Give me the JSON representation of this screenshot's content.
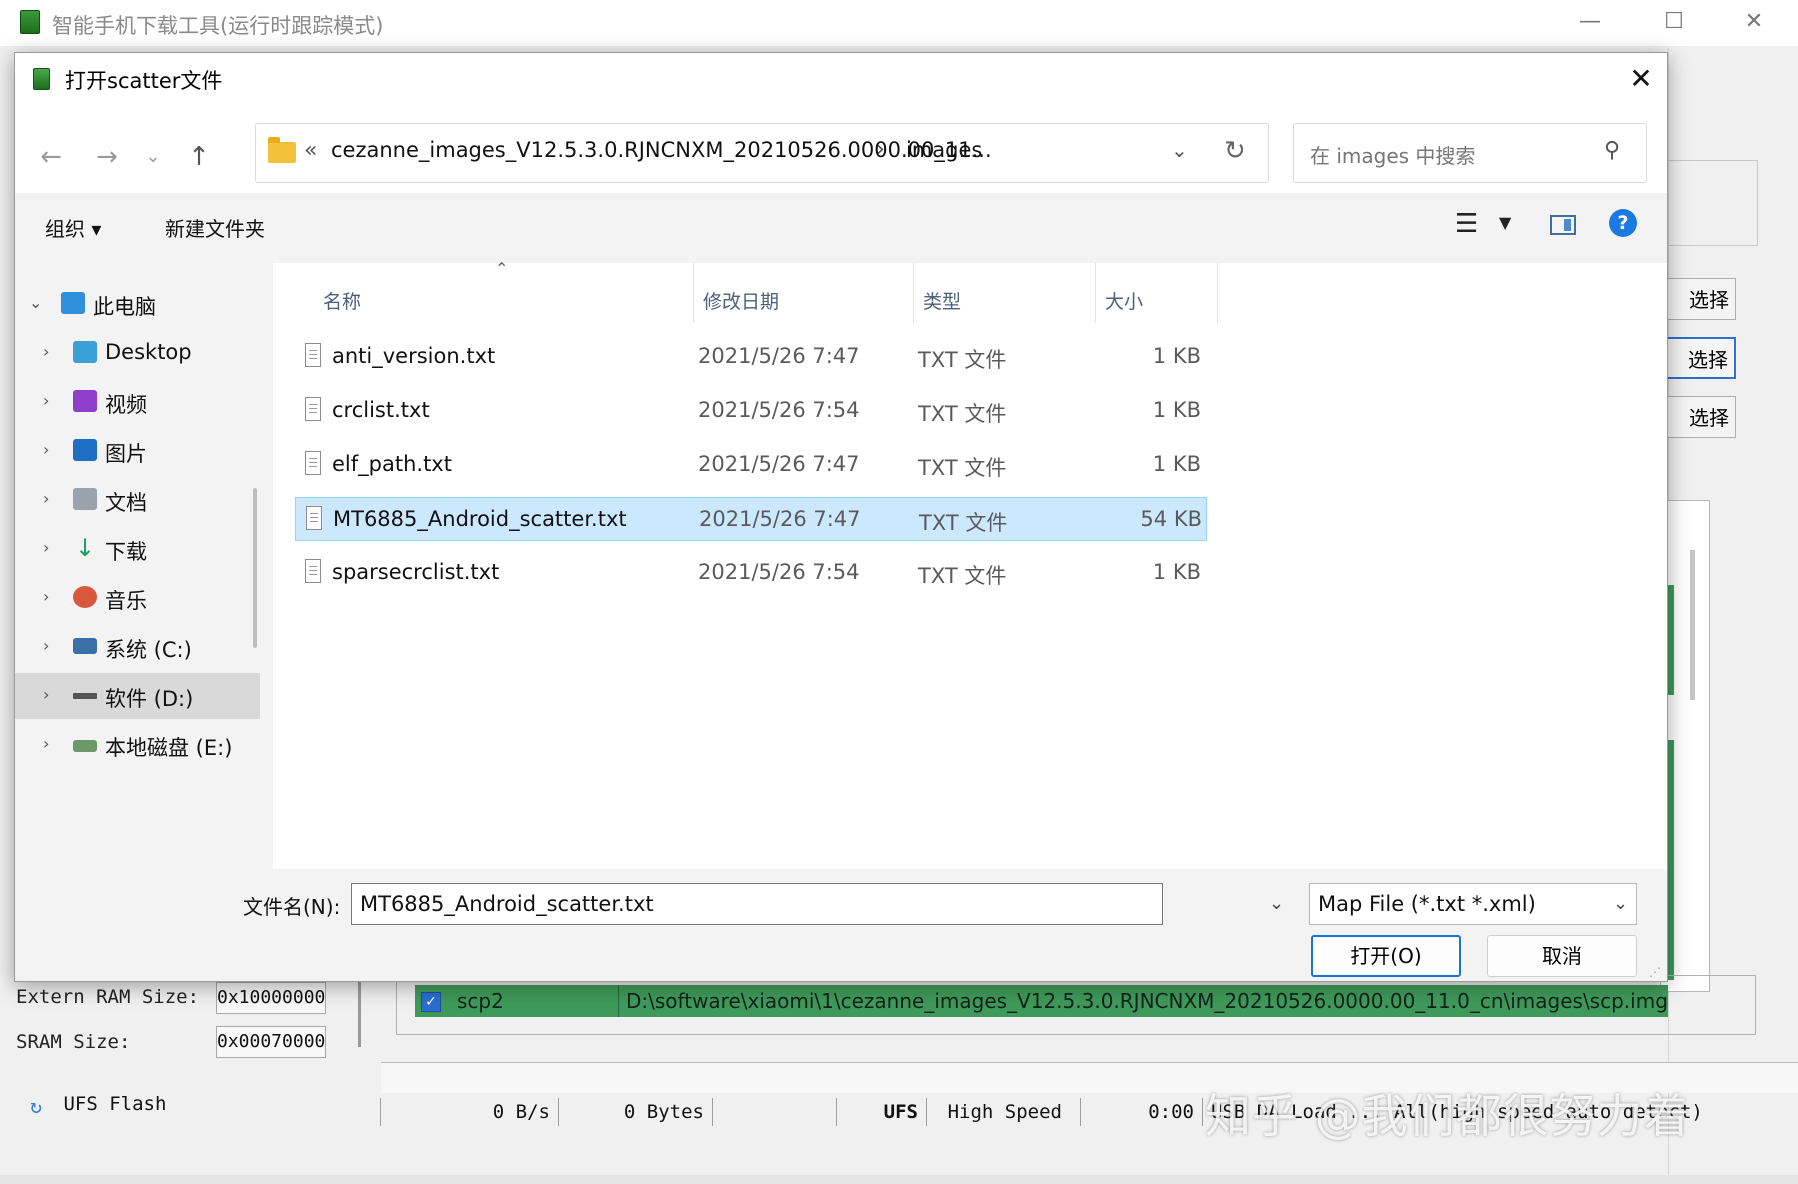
{
  "app": {
    "title": "智能手机下载工具(运行时跟踪模式)",
    "minimize": "—",
    "maximize": "☐",
    "close": "✕",
    "side_buttons": [
      "选择",
      "选择",
      "选择"
    ],
    "extern_ram_label": "Extern RAM Size:",
    "extern_ram_value": "0x100000000",
    "sram_label": "SRAM Size:",
    "sram_value": "0x00070000",
    "storage_label": "UFS Flash",
    "scp_row": {
      "checked": true,
      "name": "scp2",
      "path": "D:\\software\\xiaomi\\1\\cezanne_images_V12.5.3.0.RJNCNXM_20210526.0000.00_11.0_cn\\images\\scp.img"
    },
    "status_bar": [
      "0 B/s",
      "0 Bytes",
      "",
      "UFS",
      "High Speed",
      "0:00",
      "USB DA Load ... All(high speed auto detect)"
    ]
  },
  "watermark": "知乎 @我们都很努力着",
  "dialog": {
    "title": "打开scatter文件",
    "close": "✕",
    "address": {
      "chevrons": "«",
      "path": "cezanne_images_V12.5.3.0.RJNCNXM_20210526.0000.00_11...",
      "current": "images"
    },
    "search": {
      "placeholder": "在 images 中搜索"
    },
    "toolbar": {
      "organize": "组织 ▾",
      "new_folder": "新建文件夹"
    },
    "nav_items": [
      {
        "label": "此电脑",
        "icon": "computer-icon",
        "expanded": true
      },
      {
        "label": "Desktop",
        "icon": "desktop-icon"
      },
      {
        "label": "视频",
        "icon": "video-icon"
      },
      {
        "label": "图片",
        "icon": "pictures-icon"
      },
      {
        "label": "文档",
        "icon": "documents-icon"
      },
      {
        "label": "下载",
        "icon": "download-icon"
      },
      {
        "label": "音乐",
        "icon": "music-icon"
      },
      {
        "label": "系统 (C:)",
        "icon": "system-drive-icon"
      },
      {
        "label": "软件 (D:)",
        "icon": "drive-icon",
        "selected": true
      },
      {
        "label": "本地磁盘 (E:)",
        "icon": "local-disk-icon"
      }
    ],
    "columns": {
      "name": "名称",
      "date": "修改日期",
      "type": "类型",
      "size": "大小"
    },
    "files": [
      {
        "name": "anti_version.txt",
        "date": "2021/5/26 7:47",
        "type": "TXT 文件",
        "size": "1 KB"
      },
      {
        "name": "crclist.txt",
        "date": "2021/5/26 7:54",
        "type": "TXT 文件",
        "size": "1 KB"
      },
      {
        "name": "elf_path.txt",
        "date": "2021/5/26 7:47",
        "type": "TXT 文件",
        "size": "1 KB"
      },
      {
        "name": "MT6885_Android_scatter.txt",
        "date": "2021/5/26 7:47",
        "type": "TXT 文件",
        "size": "54 KB",
        "selected": true
      },
      {
        "name": "sparsecrclist.txt",
        "date": "2021/5/26 7:54",
        "type": "TXT 文件",
        "size": "1 KB"
      }
    ],
    "filename_label": "文件名(N):",
    "filename_value": "MT6885_Android_scatter.txt",
    "filter": "Map File (*.txt *.xml)",
    "open_button": "打开(O)",
    "cancel_button": "取消"
  }
}
